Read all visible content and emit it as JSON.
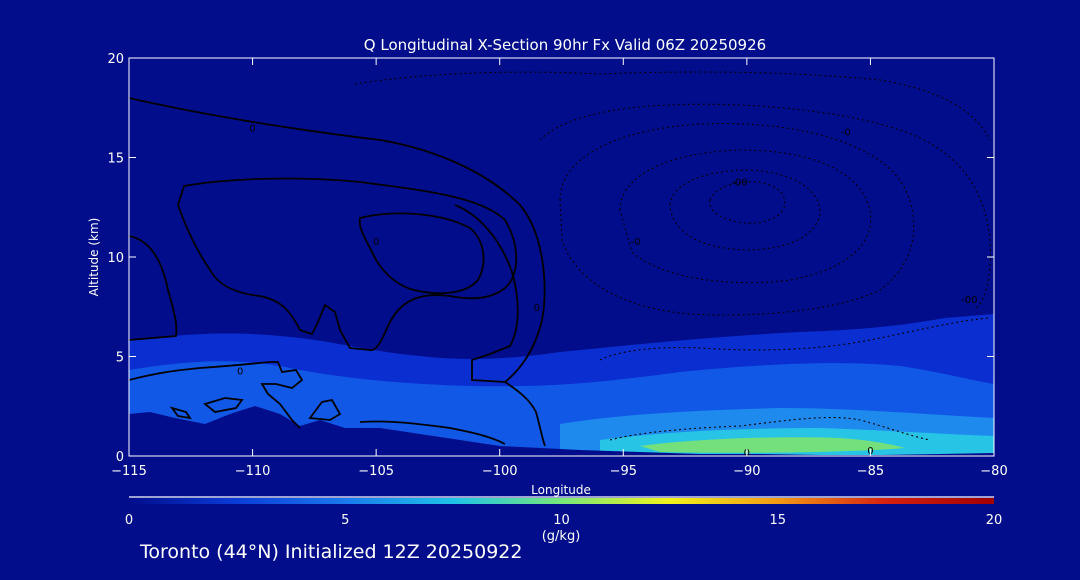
{
  "chart_data": {
    "type": "heatmap",
    "title": "Q Longitudinal X-Section 90hr  Fx Valid 06Z 20250926",
    "xlabel": "Longitude",
    "ylabel": "Altitude (km)",
    "xlim": [
      -115,
      -80
    ],
    "ylim": [
      0,
      20
    ],
    "xticks": [
      "−115",
      "−110",
      "−105",
      "−100",
      "−95",
      "−90",
      "−85",
      "−80"
    ],
    "xtick_values": [
      -115,
      -110,
      -105,
      -100,
      -95,
      -90,
      -85,
      -80
    ],
    "yticks": [
      "0",
      "5",
      "10",
      "15",
      "20"
    ],
    "ytick_values": [
      0,
      5,
      10,
      15,
      20
    ],
    "colorbar": {
      "label": "(g/kg)",
      "range": [
        0,
        20
      ],
      "ticks": [
        "0",
        "5",
        "10",
        "15",
        "20"
      ],
      "tick_values": [
        0,
        5,
        10,
        15,
        20
      ],
      "colors": [
        "#020d8c",
        "#0a3dd8",
        "#1a7aee",
        "#1fc3e8",
        "#78e87a",
        "#f2f21a",
        "#f39a14",
        "#d62010",
        "#a00000"
      ]
    },
    "filled_regions": [
      {
        "name": "",
        "value_range": [
          0,
          2
        ],
        "lon": [
          -115,
          -80
        ],
        "alt": [
          0,
          7
        ]
      },
      {
        "name": "",
        "value_range": [
          2,
          4
        ],
        "lon": [
          -115,
          -80
        ],
        "alt": [
          0,
          4.5
        ]
      },
      {
        "name": "",
        "value_range": [
          4,
          7
        ],
        "lon": [
          -100,
          -80
        ],
        "alt": [
          0,
          2
        ]
      },
      {
        "name": "",
        "value_range": [
          10,
          13
        ],
        "lon": [
          -96,
          -83
        ],
        "alt": [
          0.2,
          0.8
        ]
      }
    ],
    "contour_labels": [
      {
        "text": "0",
        "lon": -110,
        "alt": 16.5
      },
      {
        "text": "0",
        "lon": -105,
        "alt": 10.8
      },
      {
        "text": "0",
        "lon": -110.5,
        "alt": 4.3
      },
      {
        "text": "0",
        "lon": -98.5,
        "alt": 7.5
      },
      {
        "text": "0",
        "lon": -90,
        "alt": 0.2
      },
      {
        "text": "0",
        "lon": -85,
        "alt": 0.3
      },
      {
        "text": "-0",
        "lon": -86,
        "alt": 16.3
      },
      {
        "text": "-0",
        "lon": -94.5,
        "alt": 10.8
      },
      {
        "text": "-00",
        "lon": -90.3,
        "alt": 13.8
      },
      {
        "text": "-00",
        "lon": -81,
        "alt": 7.9
      }
    ],
    "grid": false,
    "legend": "colorbar-bottom"
  },
  "footer": {
    "text": "Toronto (44°N) Initialized 12Z 20250922"
  },
  "colors": {
    "background": "#020d8c",
    "axis": "#ffffff",
    "contour": "#000000",
    "terrain": "#020d8c"
  }
}
